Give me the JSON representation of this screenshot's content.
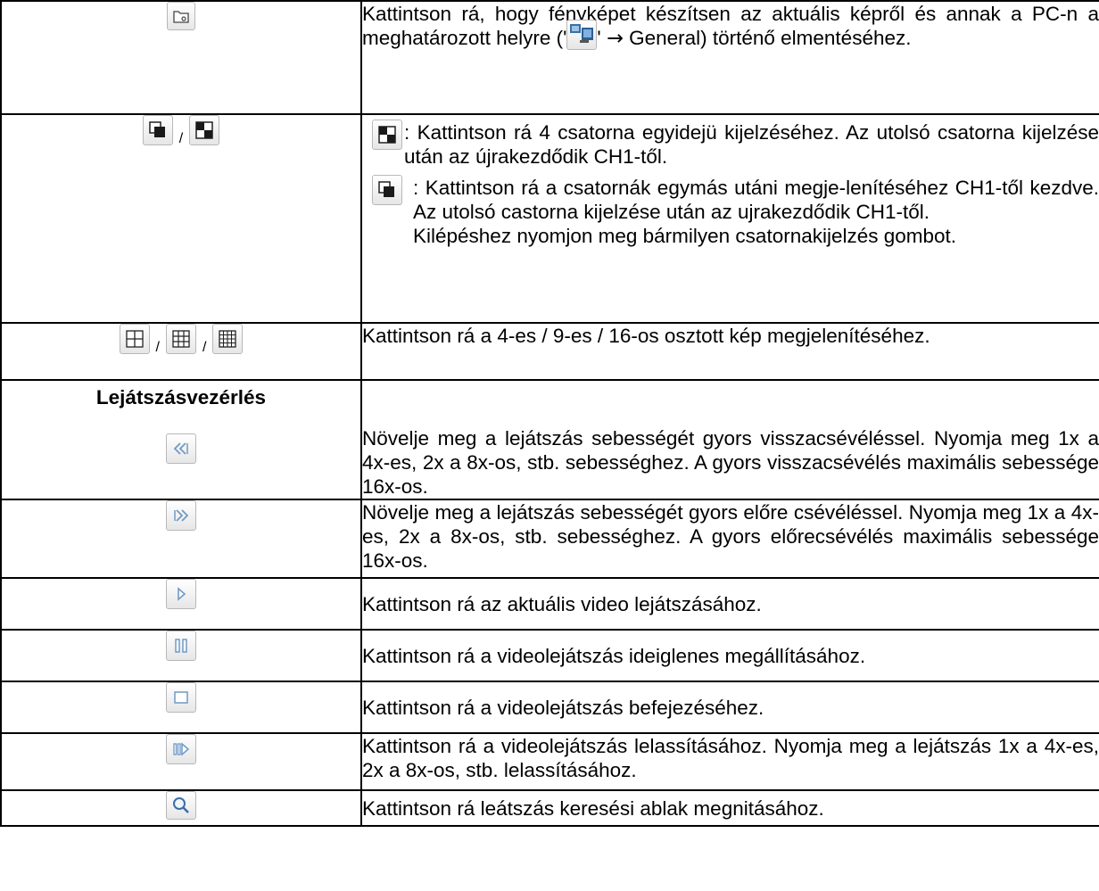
{
  "rows": [
    {
      "icon": "folder-snapshot-icon",
      "text_a": "Kattintson rá, hogy fényképet készítsen az aktuális képről és annak a PC-n a meghatározott helyre ('",
      "inline_icon": "pc-settings-icon",
      "text_b": "' ",
      "arrow": "→",
      "text_c": " General) történő elmentéséhez."
    },
    {
      "icons": [
        "sequence-icon",
        "quad-view-icon"
      ],
      "separator": "/",
      "item1_text": ": Kattintson rá 4 csatorna egyidejü kijelzéséhez. Az utolsó csatorna kijelzése után az újrakezdődik CH1-től.",
      "item2_text": ": Kattintson rá a csatornák egymás utáni megje-lenítéséhez CH1-től kezdve. Az utolsó castorna kijelzése után az ujrakezdődik CH1-től.",
      "item2_extra": "Kilépéshez nyomjon meg bármilyen csatornakijelzés gombot."
    },
    {
      "icons": [
        "grid-4-icon",
        "grid-9-icon",
        "grid-16-icon"
      ],
      "separator": "/",
      "text": "Kattintson rá a 4-es / 9-es / 16-os osztott kép megjelenítéséhez."
    },
    {
      "heading": "Lejátszásvezérlés",
      "icon": "rewind-icon",
      "text": "Növelje meg a lejátszás sebességét gyors visszacsévéléssel. Nyomja meg 1x a 4x-es, 2x a 8x-os, stb. sebességhez. A gyors visszacsévélés maximális sebessége 16x-os."
    },
    {
      "icon": "fast-forward-icon",
      "text": "Növelje meg a lejátszás sebességét gyors előre csévéléssel. Nyomja meg 1x a 4x-es, 2x a 8x-os, stb. sebességhez. A gyors előrecsévélés maximális sebessége 16x-os."
    },
    {
      "icon": "play-icon",
      "text": "Kattintson rá az aktuális video lejátszásához."
    },
    {
      "icon": "pause-icon",
      "text": "Kattintson rá a videolejátszás ideiglenes megállításához."
    },
    {
      "icon": "stop-icon",
      "text": "Kattintson rá a videolejátszás befejezéséhez."
    },
    {
      "icon": "slow-play-icon",
      "text": "Kattintson rá a videolejátszás lelassításához. Nyomja meg a lejátszás 1x a 4x-es, 2x a 8x-os, stb. lelassításához."
    },
    {
      "icon": "search-icon",
      "text": "Kattintson rá leátszás keresési ablak megnitásához."
    }
  ],
  "colors": {
    "border": "#000000",
    "icon_blue": "#7aa3cc",
    "icon_dark": "#1a1a1a"
  }
}
